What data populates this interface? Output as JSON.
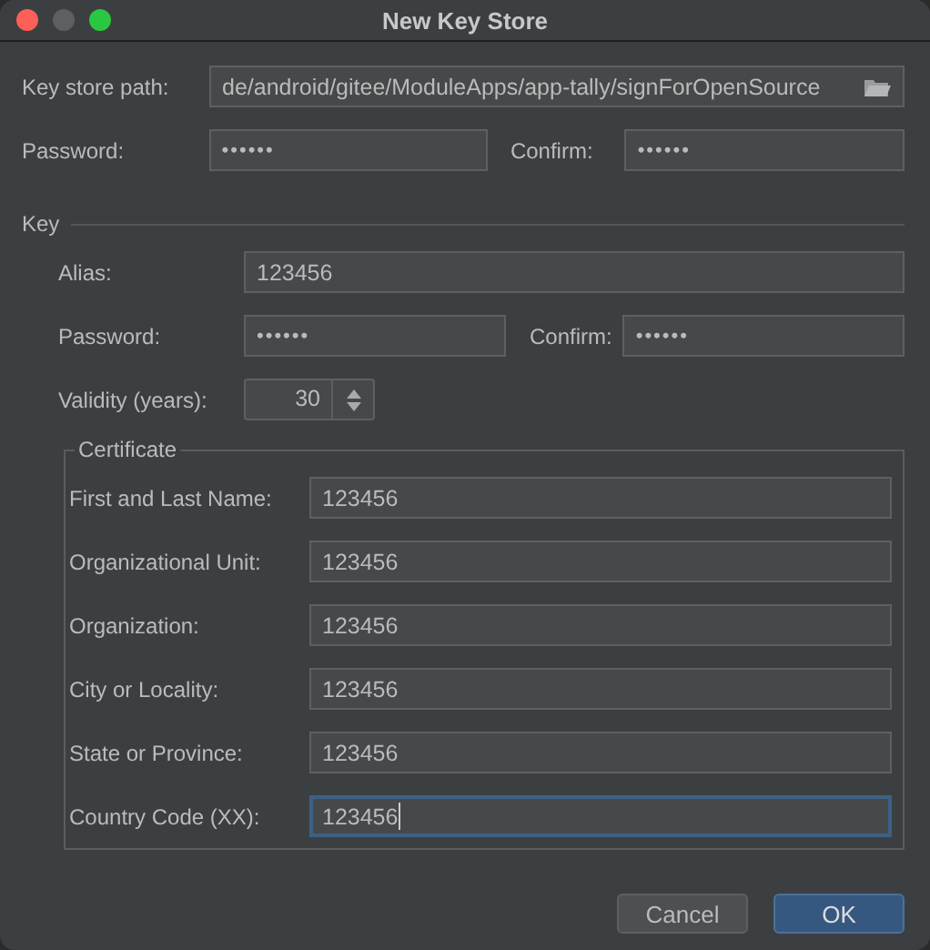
{
  "window": {
    "title": "New Key Store"
  },
  "keystore": {
    "path": {
      "label": "Key store path:",
      "value": "de/android/gitee/ModuleApps/app-tally/signForOpenSource"
    },
    "password": {
      "label": "Password:",
      "value": "••••••"
    },
    "confirm": {
      "label": "Confirm:",
      "value": "••••••"
    }
  },
  "key": {
    "title": "Key",
    "alias": {
      "label": "Alias:",
      "value": "123456"
    },
    "password": {
      "label": "Password:",
      "value": "••••••"
    },
    "confirm": {
      "label": "Confirm:",
      "value": "••••••"
    },
    "validity": {
      "label": "Validity (years):",
      "value": "30"
    },
    "certificate": {
      "title": "Certificate",
      "fields": [
        {
          "label": "First and Last Name:",
          "value": "123456",
          "focused": false
        },
        {
          "label": "Organizational Unit:",
          "value": "123456",
          "focused": false
        },
        {
          "label": "Organization:",
          "value": "123456",
          "focused": false
        },
        {
          "label": "City or Locality:",
          "value": "123456",
          "focused": false
        },
        {
          "label": "State or Province:",
          "value": "123456",
          "focused": false
        },
        {
          "label": "Country Code (XX):",
          "value": "123456",
          "focused": true
        }
      ]
    }
  },
  "buttons": [
    {
      "label": "Cancel",
      "default": false
    },
    {
      "label": "OK",
      "default": true
    }
  ]
}
